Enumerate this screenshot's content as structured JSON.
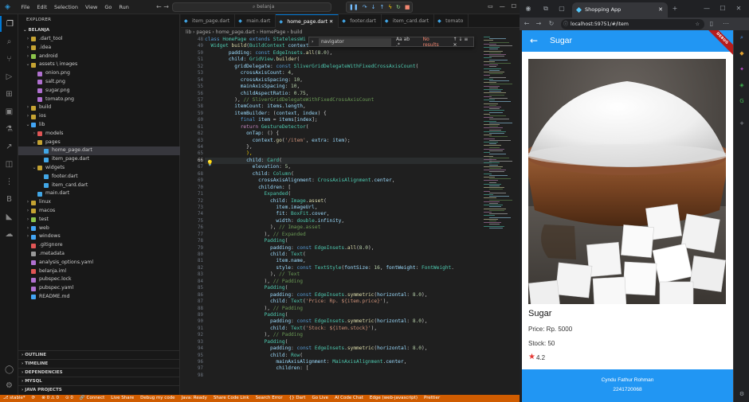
{
  "vscode": {
    "menu": [
      "File",
      "Edit",
      "Selection",
      "View",
      "Go",
      "Run"
    ],
    "search": "belanja",
    "explorer_title": "EXPLORER",
    "workspace": "BELANJA",
    "tree": [
      {
        "label": ".dart_tool",
        "depth": 1,
        "chev": "›",
        "color": "#c5a332"
      },
      {
        "label": ".idea",
        "depth": 1,
        "chev": "›",
        "color": "#c5a332"
      },
      {
        "label": "android",
        "depth": 1,
        "chev": "›",
        "color": "#8bc34a"
      },
      {
        "label": "assets \\ images",
        "depth": 1,
        "chev": "⌄",
        "color": "#c5a332"
      },
      {
        "label": "onion.png",
        "depth": 2,
        "chev": "",
        "color": "#b070d0"
      },
      {
        "label": "salt.png",
        "depth": 2,
        "chev": "",
        "color": "#b070d0"
      },
      {
        "label": "sugar.png",
        "depth": 2,
        "chev": "",
        "color": "#b070d0"
      },
      {
        "label": "tomato.png",
        "depth": 2,
        "chev": "",
        "color": "#b070d0"
      },
      {
        "label": "build",
        "depth": 1,
        "chev": "›",
        "color": "#c5a332"
      },
      {
        "label": "ios",
        "depth": 1,
        "chev": "›",
        "color": "#c5a332"
      },
      {
        "label": "lib",
        "depth": 1,
        "chev": "⌄",
        "color": "#42a5f5"
      },
      {
        "label": "models",
        "depth": 2,
        "chev": "›",
        "color": "#e05555"
      },
      {
        "label": "pages",
        "depth": 2,
        "chev": "⌄",
        "color": "#c5a332"
      },
      {
        "label": "home_page.dart",
        "depth": 3,
        "chev": "",
        "color": "#41a6e6",
        "sel": true
      },
      {
        "label": "item_page.dart",
        "depth": 3,
        "chev": "",
        "color": "#41a6e6"
      },
      {
        "label": "widgets",
        "depth": 2,
        "chev": "⌄",
        "color": "#c5a332"
      },
      {
        "label": "footer.dart",
        "depth": 3,
        "chev": "",
        "color": "#41a6e6"
      },
      {
        "label": "item_card.dart",
        "depth": 3,
        "chev": "",
        "color": "#41a6e6"
      },
      {
        "label": "main.dart",
        "depth": 2,
        "chev": "",
        "color": "#41a6e6"
      },
      {
        "label": "linux",
        "depth": 1,
        "chev": "›",
        "color": "#c5a332"
      },
      {
        "label": "macos",
        "depth": 1,
        "chev": "›",
        "color": "#c5a332"
      },
      {
        "label": "test",
        "depth": 1,
        "chev": "›",
        "color": "#8bc34a"
      },
      {
        "label": "web",
        "depth": 1,
        "chev": "›",
        "color": "#42a5f5"
      },
      {
        "label": "windows",
        "depth": 1,
        "chev": "›",
        "color": "#42a5f5"
      },
      {
        "label": ".gitignore",
        "depth": 1,
        "chev": "",
        "color": "#e05555"
      },
      {
        "label": ".metadata",
        "depth": 1,
        "chev": "",
        "color": "#999999"
      },
      {
        "label": "analysis_options.yaml",
        "depth": 1,
        "chev": "",
        "color": "#b070d0"
      },
      {
        "label": "belanja.iml",
        "depth": 1,
        "chev": "",
        "color": "#e05555"
      },
      {
        "label": "pubspec.lock",
        "depth": 1,
        "chev": "",
        "color": "#b070d0"
      },
      {
        "label": "pubspec.yaml",
        "depth": 1,
        "chev": "",
        "color": "#b070d0"
      },
      {
        "label": "README.md",
        "depth": 1,
        "chev": "",
        "color": "#42a5f5"
      }
    ],
    "bottom_sections": [
      "OUTLINE",
      "TIMELINE",
      "DEPENDENCIES",
      "MYSQL",
      "JAVA PROJECTS"
    ],
    "tabs": [
      "item_page.dart",
      "main.dart",
      "home_page.dart",
      "footer.dart",
      "item_card.dart",
      "tomato"
    ],
    "active_tab": "home_page.dart",
    "breadcrumb": "lib › pages › home_page.dart › HomePage › build",
    "find": {
      "label": "navigator",
      "options": "Aa ab .*",
      "result": "No results",
      "buttons": "↑ ↓ ≡ ✕"
    },
    "line_numbers": [
      "48",
      "49",
      "50",
      "51",
      "52",
      "53",
      "54",
      "55",
      "56",
      "57",
      "58",
      "59",
      "60",
      "61",
      "62",
      "63",
      "64",
      "65",
      "66",
      "67",
      "68",
      "69",
      "70",
      "71",
      "72",
      "73",
      "74",
      "75",
      "76",
      "77",
      "78",
      "79",
      "80",
      "81",
      "82",
      "83",
      "84",
      "85",
      "86",
      "87",
      "88",
      "89",
      "90",
      "91",
      "92",
      "93",
      "94",
      "95",
      "96",
      "97",
      "98"
    ],
    "current_line": "66",
    "status": [
      "⎇ stable*",
      "⟳",
      "⊗ 0 ⚠ 0",
      "⊙ 0",
      "🔗 Connect",
      "Live Share",
      "Debug my code",
      "Java: Ready",
      "Share Code Link",
      "Search Error",
      "{} Dart",
      "Go Live",
      "AI Code Chat",
      "Edge (web-javascript)",
      "Prettier"
    ]
  },
  "browser": {
    "tab_title": "Shopping App",
    "url": "localhost:59751/#/item"
  },
  "app": {
    "title": "Sugar",
    "debug": "DEBUG",
    "name": "Sugar",
    "price": "Price: Rp. 5000",
    "stock": "Stock: 50",
    "rating": "4.2",
    "footer_name": "Cyndu Fathur Rohman",
    "footer_id": "2241720068"
  },
  "colors": {
    "accent": "#2196f3",
    "status": "#d05c00",
    "rating_star": "#e53935"
  }
}
